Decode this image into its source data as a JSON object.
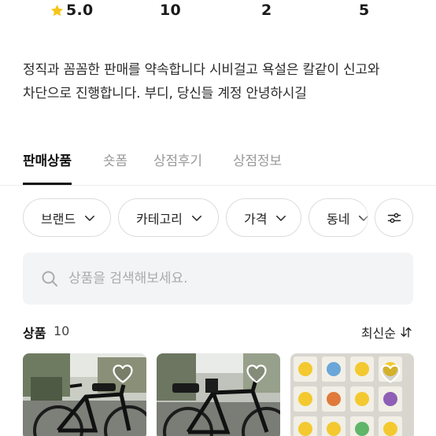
{
  "stats": {
    "rating": "5.0",
    "stat2": "10",
    "stat3": "2",
    "stat4": "5",
    "star_icon": "star-icon",
    "star_color": "#f5c518"
  },
  "bio": {
    "line1": "정직과 꼼꼼한 판매를 약속합니다 시비걸고 욕설은 칼같이 신고와",
    "line2": "차단으로 진행합니다. 부디, 당신들 계정 안녕하시길"
  },
  "tabs": [
    {
      "label": "판매상품",
      "active": true
    },
    {
      "label": "숏폼",
      "active": false
    },
    {
      "label": "상점후기",
      "active": false
    },
    {
      "label": "상점정보",
      "active": false
    }
  ],
  "filters": [
    {
      "label": "브랜드",
      "icon": "chevron-down-icon"
    },
    {
      "label": "카테고리",
      "icon": "chevron-down-icon"
    },
    {
      "label": "가격",
      "icon": "chevron-down-icon"
    },
    {
      "label": "동네",
      "icon": "chevron-down-icon"
    }
  ],
  "filter_settings_icon": "sliders-icon",
  "search": {
    "placeholder": "상품을 검색해보세요.",
    "icon": "search-icon"
  },
  "products": {
    "title": "상품",
    "count": "10",
    "sort_label": "최신순",
    "sort_icon": "sort-arrows-icon"
  },
  "items": [
    {
      "image": "black-road-bike-photo",
      "icon": "heart-icon"
    },
    {
      "image": "black-road-bike-photo",
      "icon": "heart-icon"
    },
    {
      "image": "pokemon-stickers-photo",
      "icon": "heart-icon"
    }
  ],
  "colors": {
    "text_primary": "#111111",
    "text_muted": "#9a9a9a",
    "border": "#dcdcdc",
    "search_bg": "#f3f4f5"
  }
}
